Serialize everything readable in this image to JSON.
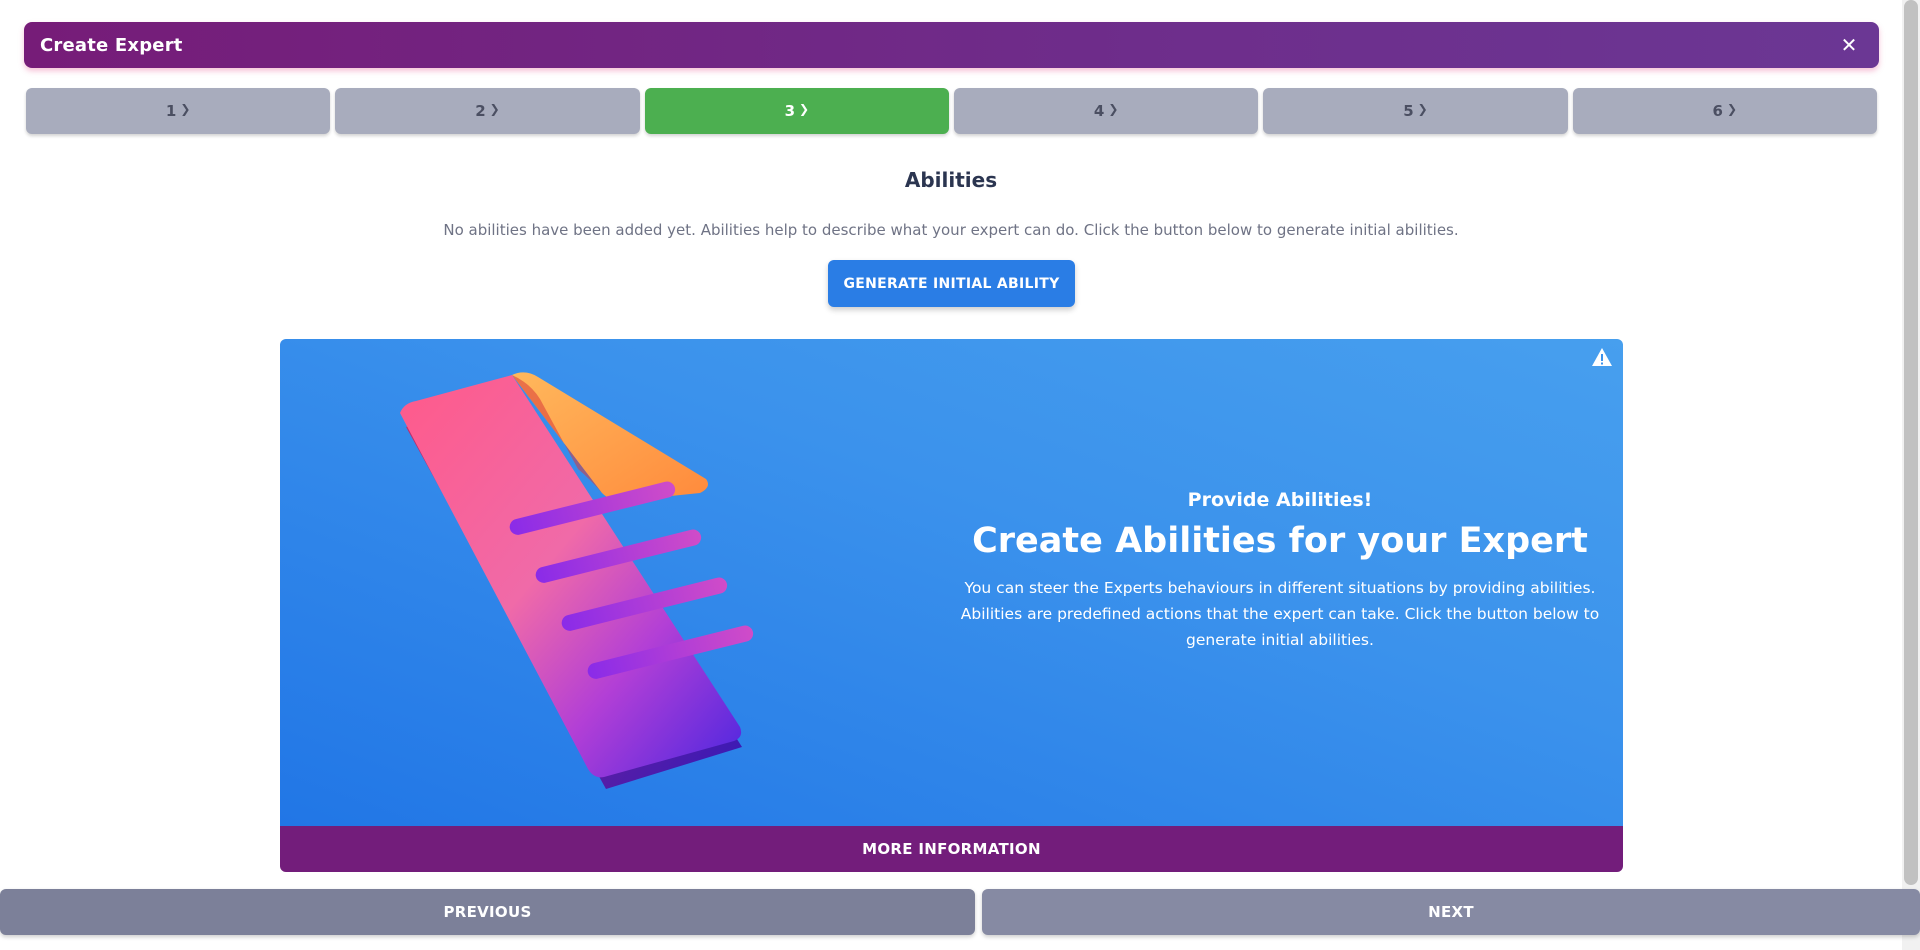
{
  "dialog": {
    "title": "Create Expert",
    "close_glyph": "✕"
  },
  "steps": [
    {
      "label": "1",
      "active": false
    },
    {
      "label": "2",
      "active": false
    },
    {
      "label": "3",
      "active": true
    },
    {
      "label": "4",
      "active": false
    },
    {
      "label": "5",
      "active": false
    },
    {
      "label": "6",
      "active": false
    }
  ],
  "abilities": {
    "title": "Abilities",
    "empty_text": "No abilities have been added yet. Abilities help to describe what your expert can do. Click the button below to generate initial abilities.",
    "generate_label": "GENERATE INITIAL ABILITY"
  },
  "banner": {
    "kicker": "Provide Abilities!",
    "title": "Create Abilities for your Expert",
    "body_line1": "You can steer the Experts behaviours in different situations by providing abilities.",
    "body_line2": "Abilities are predefined actions that the expert can take. Click the button below to",
    "body_line3": "generate initial abilities.",
    "more_info_label": "MORE INFORMATION",
    "warning_icon": "warning-icon",
    "illustration": "document-illustration"
  },
  "footer": {
    "previous_label": "PREVIOUS",
    "next_label": "NEXT"
  },
  "colors": {
    "header": "#761c78",
    "step_active": "#4caf50",
    "step_inactive": "#a8acbd",
    "primary_button": "#2a7de5",
    "banner_blue": "#2176e6",
    "more_info": "#731d7b"
  }
}
